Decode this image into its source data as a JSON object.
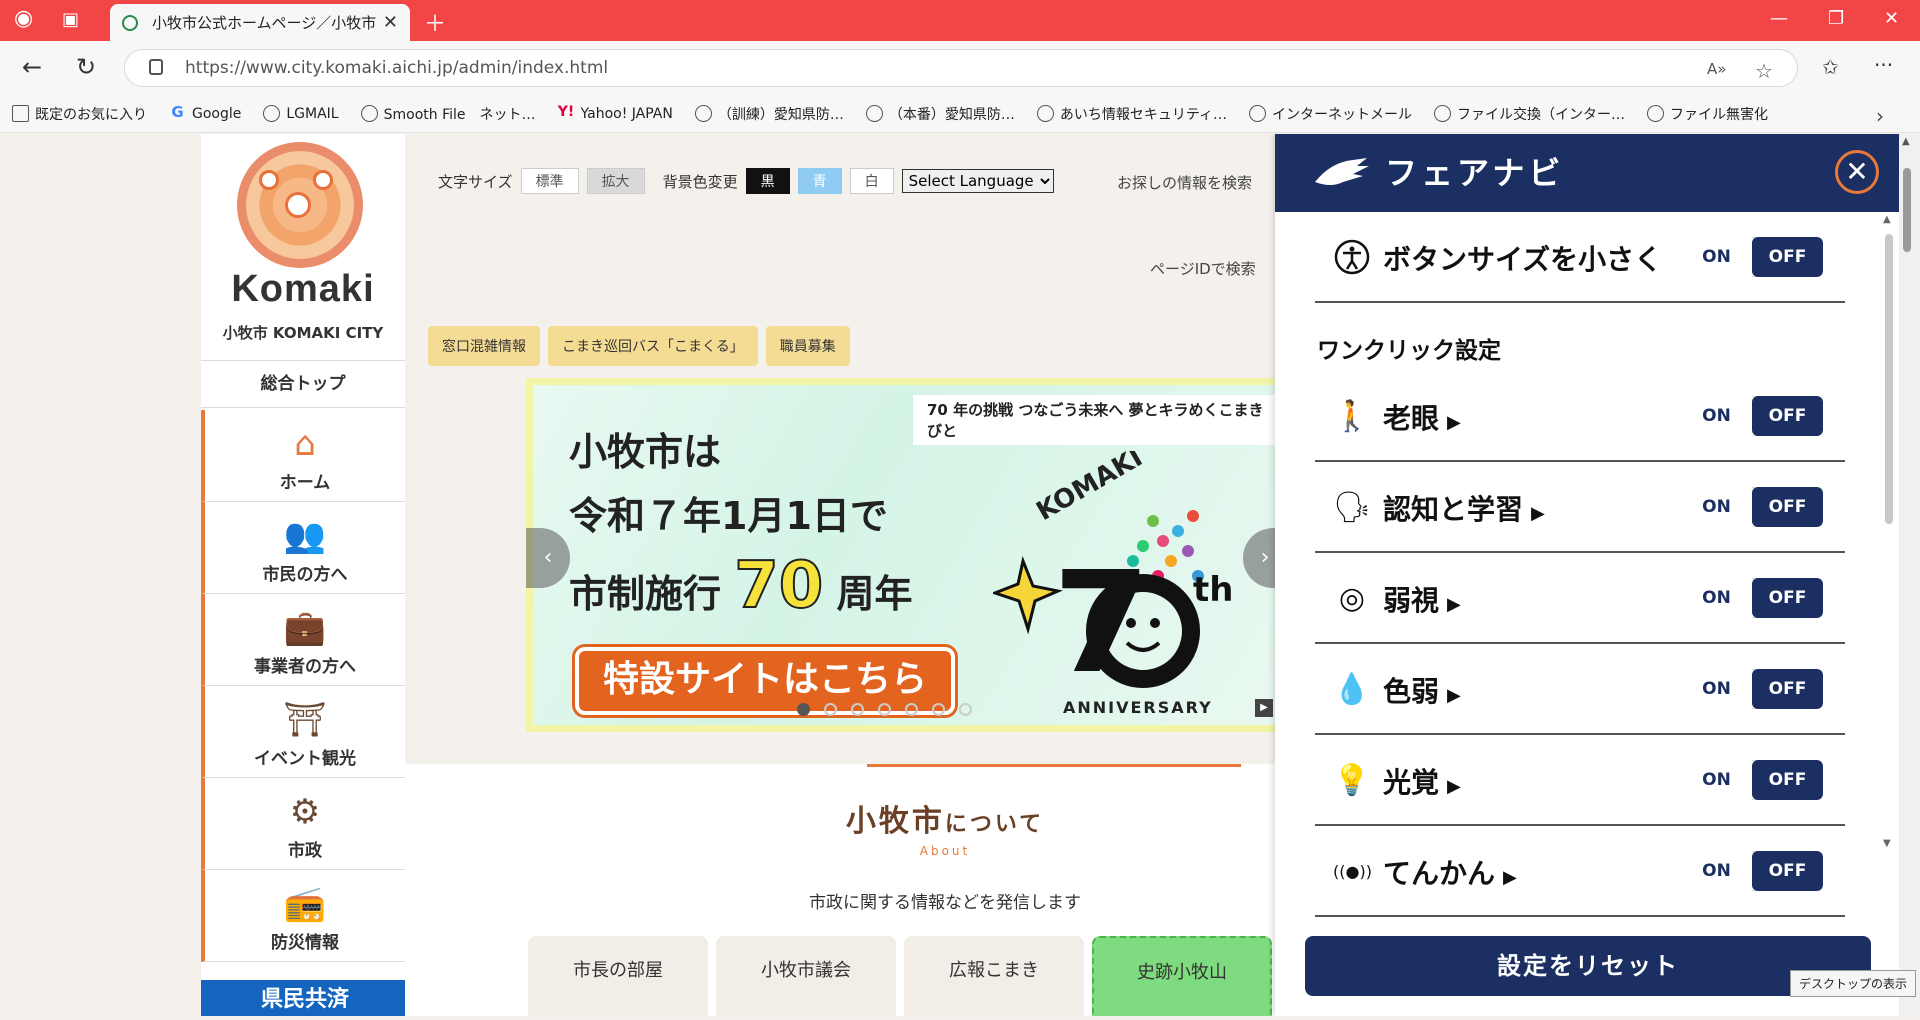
{
  "browser": {
    "tab_title": "小牧市公式ホームページ／小牧市",
    "url": "https://www.city.komaki.aichi.jp/admin/index.html",
    "accent": "#f24545",
    "bookmarks": [
      {
        "label": "既定のお気に入り",
        "icon": "folder-icon"
      },
      {
        "label": "Google",
        "icon": "google-icon"
      },
      {
        "label": "LGMAIL",
        "icon": "globe-icon"
      },
      {
        "label": "Smooth File　ネット…",
        "icon": "globe-icon"
      },
      {
        "label": "Yahoo! JAPAN",
        "icon": "yahoo-icon"
      },
      {
        "label": "（訓練）愛知県防…",
        "icon": "globe-icon"
      },
      {
        "label": "（本番）愛知県防…",
        "icon": "globe-icon"
      },
      {
        "label": "あいち情報セキュリティ…",
        "icon": "globe-icon"
      },
      {
        "label": "インターネットメール",
        "icon": "globe-icon"
      },
      {
        "label": "ファイル交換（インター…",
        "icon": "globe-icon"
      },
      {
        "label": "ファイル無害化",
        "icon": "globe-icon"
      }
    ]
  },
  "site": {
    "logo_word": "Komaki",
    "logo_city": "小牧市  KOMAKI CITY",
    "top_label": "総合トップ",
    "side_items": [
      {
        "label": "ホーム",
        "icon": "home-icon",
        "glyph": "⌂"
      },
      {
        "label": "市民の方へ",
        "icon": "people-icon",
        "glyph": "👥"
      },
      {
        "label": "事業者の方へ",
        "icon": "briefcase-icon",
        "glyph": "💼"
      },
      {
        "label": "イベント観光",
        "icon": "castle-icon",
        "glyph": "⛩"
      },
      {
        "label": "市政",
        "icon": "city-emblem-icon",
        "glyph": "⚙"
      },
      {
        "label": "防災情報",
        "icon": "radio-icon",
        "glyph": "📻"
      }
    ],
    "side_banner": "県民共済",
    "header": {
      "font_size_label": "文字サイズ",
      "font_standard": "標準",
      "font_large": "拡大",
      "bg_color_label": "背景色変更",
      "bg_black": "黒",
      "bg_blue": "青",
      "bg_white": "白",
      "language": "Select Language",
      "search_text": "お探しの情報を検索",
      "pageid_text": "ページIDで検索"
    },
    "pills": [
      "窓口混雑情報",
      "こまき巡回バス「こまくる」",
      "職員募集"
    ],
    "banner": {
      "tag": "70 年の挑戦 つなごう未来へ 夢とキラめくこまきびと",
      "line1": "小牧市は",
      "line2": "令和７年1月1日で",
      "line3_pre": "市制施行 ",
      "line3_big": "70",
      "line3_post": " 周年",
      "cta": "特設サイトはこちら",
      "logo_text": "KOMAKI",
      "logo_anniv": "ANNIVERSARY",
      "logo_th": "th",
      "dots": 7,
      "active_dot": 0
    },
    "about": {
      "title": "小牧市",
      "title_suffix": "について",
      "en": "About",
      "desc": "市政に関する情報などを発信します",
      "cards": [
        "市長の部屋",
        "小牧市議会",
        "広報こまき",
        "史跡小牧山"
      ]
    }
  },
  "fairnavi": {
    "title": "フェアナビ",
    "toggle_on": "ON",
    "toggle_off": "OFF",
    "button_size_row": {
      "label": "ボタンサイズを小さく",
      "icon": "accessibility-icon"
    },
    "section_title": "ワンクリック設定",
    "rows": [
      {
        "label": "老眼",
        "icon": "elderly-walker-icon",
        "glyph": "🚶"
      },
      {
        "label": "認知と学習",
        "icon": "speaking-head-icon",
        "glyph": "🗣"
      },
      {
        "label": "弱視",
        "icon": "eye-slash-icon",
        "glyph": "◎"
      },
      {
        "label": "色弱",
        "icon": "color-drop-slash-icon",
        "glyph": "💧"
      },
      {
        "label": "光覚",
        "icon": "light-bulb-icon",
        "glyph": "💡"
      },
      {
        "label": "てんかん",
        "icon": "broadcast-icon",
        "glyph": "((●))"
      }
    ],
    "reset": "設定をリセット",
    "brand_color": "#1c2f63",
    "accent_color": "#e8793a"
  },
  "tooltip": "デスクトップの表示"
}
